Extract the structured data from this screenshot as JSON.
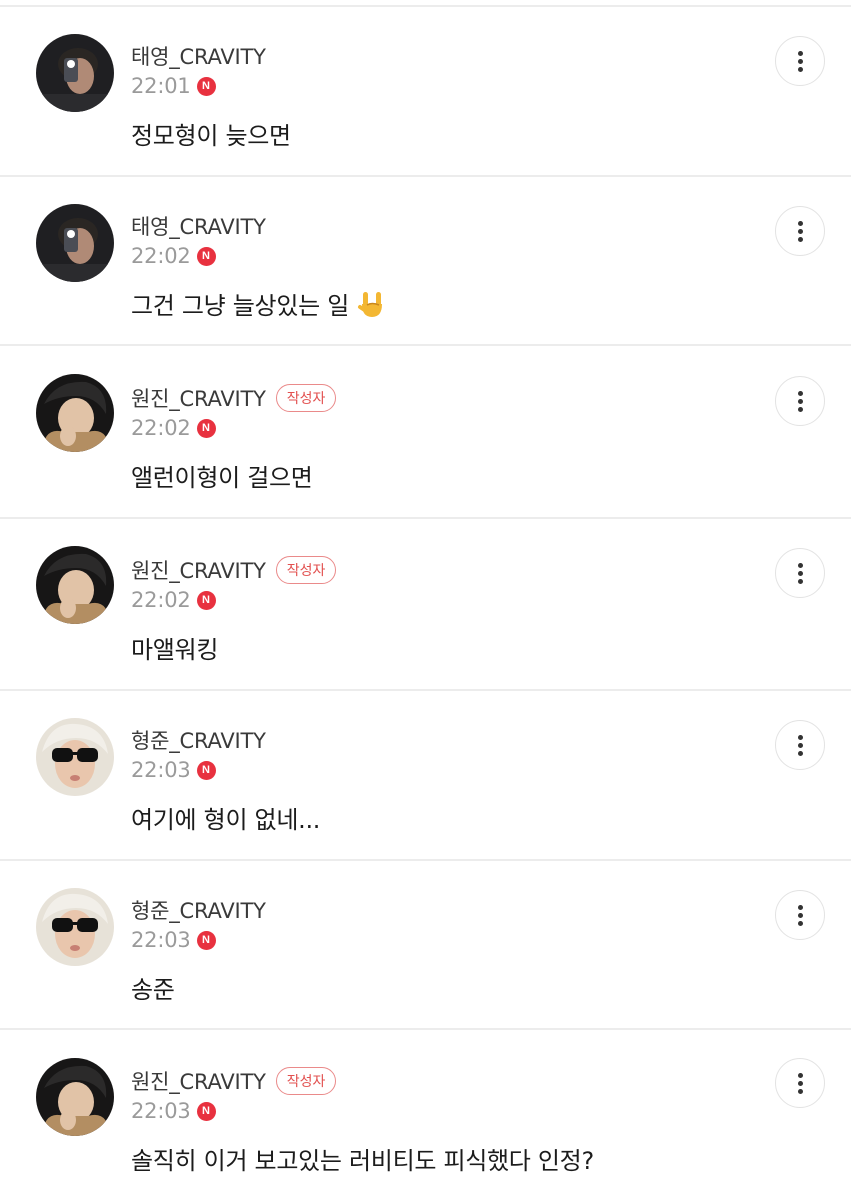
{
  "comments": [
    {
      "author": "태영_CRAVITY",
      "author_badge": "",
      "time": "22:01",
      "new_badge": "N",
      "text": "정모형이 늦으면",
      "emoji": "",
      "avatar_icon": "avatar-taeyoung-icon"
    },
    {
      "author": "태영_CRAVITY",
      "author_badge": "",
      "time": "22:02",
      "new_badge": "N",
      "text": "그건 그냥 늘상있는 일",
      "emoji": "sign-of-horns-emoji",
      "avatar_icon": "avatar-taeyoung-icon"
    },
    {
      "author": "원진_CRAVITY",
      "author_badge": "작성자",
      "time": "22:02",
      "new_badge": "N",
      "text": "앨런이형이 걸으면",
      "emoji": "",
      "avatar_icon": "avatar-wonjin-icon"
    },
    {
      "author": "원진_CRAVITY",
      "author_badge": "작성자",
      "time": "22:02",
      "new_badge": "N",
      "text": "마앨워킹",
      "emoji": "",
      "avatar_icon": "avatar-wonjin-icon"
    },
    {
      "author": "형준_CRAVITY",
      "author_badge": "",
      "time": "22:03",
      "new_badge": "N",
      "text": "여기에 형이 없네...",
      "emoji": "",
      "avatar_icon": "avatar-hyeongjun-icon"
    },
    {
      "author": "형준_CRAVITY",
      "author_badge": "",
      "time": "22:03",
      "new_badge": "N",
      "text": "송준",
      "emoji": "",
      "avatar_icon": "avatar-hyeongjun-icon"
    },
    {
      "author": "원진_CRAVITY",
      "author_badge": "작성자",
      "time": "22:03",
      "new_badge": "N",
      "text": "솔직히 이거 보고있는 러비티도 피식했다 인정?",
      "emoji": "",
      "avatar_icon": "avatar-wonjin-icon"
    }
  ],
  "colors": {
    "divider": "#ececec",
    "new_badge": "#e8313f",
    "writer_badge": "#e2504f",
    "name": "#3a3a3a",
    "time": "#9a9a9a"
  },
  "icons": {
    "more": "more-vertical-icon"
  }
}
